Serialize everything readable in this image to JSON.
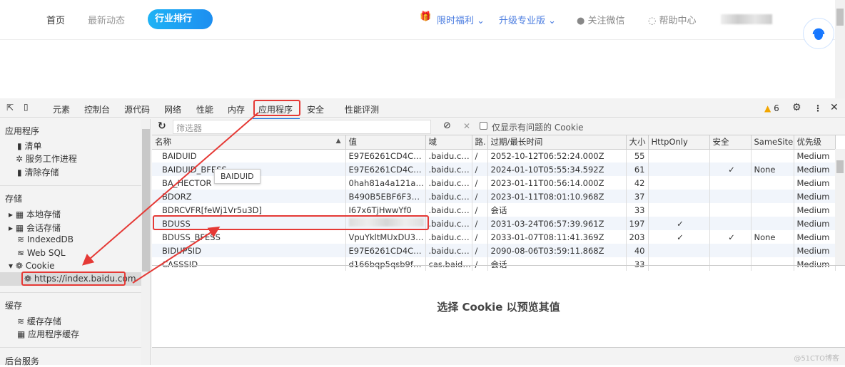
{
  "site_nav": {
    "home": "首页",
    "news": "最新动态",
    "ranking": "行业排行",
    "welfare": "限时福利",
    "upgrade": "升级专业版",
    "wechat": "关注微信",
    "help": "帮助中心"
  },
  "devtools": {
    "tabs": [
      "元素",
      "控制台",
      "源代码",
      "网络",
      "性能",
      "内存",
      "应用程序",
      "安全",
      "性能评测"
    ],
    "active_tab": "应用程序",
    "warning_count": "6",
    "sidebar": {
      "app_header": "应用程序",
      "manifest": "清单",
      "service_workers": "服务工作进程",
      "clear_storage": "清除存储",
      "storage_header": "存储",
      "local_storage": "本地存储",
      "session_storage": "会话存储",
      "indexeddb": "IndexedDB",
      "websql": "Web SQL",
      "cookie": "Cookie",
      "cookie_url": "https://index.baidu.com",
      "cache_header": "缓存",
      "cache_storage": "缓存存储",
      "app_cache": "应用程序缓存",
      "background_header": "后台服务"
    },
    "filter_placeholder": "筛选器",
    "only_issues_label": "仅显示有问题的 Cookie",
    "columns": [
      "名称",
      "值",
      "域",
      "路.",
      "过期/最长时间",
      "大小",
      "HttpOnly",
      "安全",
      "SameSite",
      "优先级"
    ],
    "rows": [
      [
        "BAIDUID",
        "E97E6261CD4C3C2...",
        ".baidu.com",
        "/",
        "2052-10-12T06:52:24.000Z",
        "55",
        "",
        "",
        "",
        "Medium"
      ],
      [
        "BAIDUID_BFESS",
        "E97E6261CD4C3C2...",
        ".baidu.com",
        "/",
        "2024-01-10T05:55:34.592Z",
        "61",
        "",
        "✓",
        "None",
        "Medium"
      ],
      [
        "BA_HECTOR",
        "0hah81a4a121ak0k...",
        ".baidu.com",
        "/",
        "2023-01-11T00:56:14.000Z",
        "42",
        "",
        "",
        "",
        "Medium"
      ],
      [
        "BDORZ",
        "B490B5EBF6F3CD4...",
        ".baidu.com",
        "/",
        "2023-01-11T08:01:10.968Z",
        "37",
        "",
        "",
        "",
        "Medium"
      ],
      [
        "BDRCVFR[feWj1Vr5u3D]",
        "I67x6TjHwwYf0",
        ".baidu.com",
        "/",
        "会话",
        "33",
        "",
        "",
        "",
        "Medium"
      ],
      [
        "BDUSS",
        "",
        ".baidu.com",
        "/",
        "2031-03-24T06:57:39.961Z",
        "197",
        "✓",
        "",
        "",
        "Medium"
      ],
      [
        "BDUSS_BFESS",
        "VpuYkltMUxDU3ZP...",
        ".baidu.com",
        "/",
        "2033-01-07T08:11:41.369Z",
        "203",
        "✓",
        "✓",
        "None",
        "Medium"
      ],
      [
        "BIDUPSID",
        "E97E6261CD4C3C2...",
        ".baidu.com",
        "/",
        "2090-08-06T03:59:11.868Z",
        "40",
        "",
        "",
        "",
        "Medium"
      ],
      [
        "CASSSID",
        "d166bqp5qsb9f67...",
        "cas.baidu....",
        "/",
        "会话",
        "33",
        "",
        "",
        "",
        "Medium"
      ]
    ],
    "tooltip": "BAIDUID",
    "preview_text": "选择 Cookie 以预览其值"
  },
  "watermark": "@51CTO博客",
  "colors": {
    "accent": "#1a73e8",
    "annotation": "#e53935",
    "pill": "#1d9af2"
  }
}
